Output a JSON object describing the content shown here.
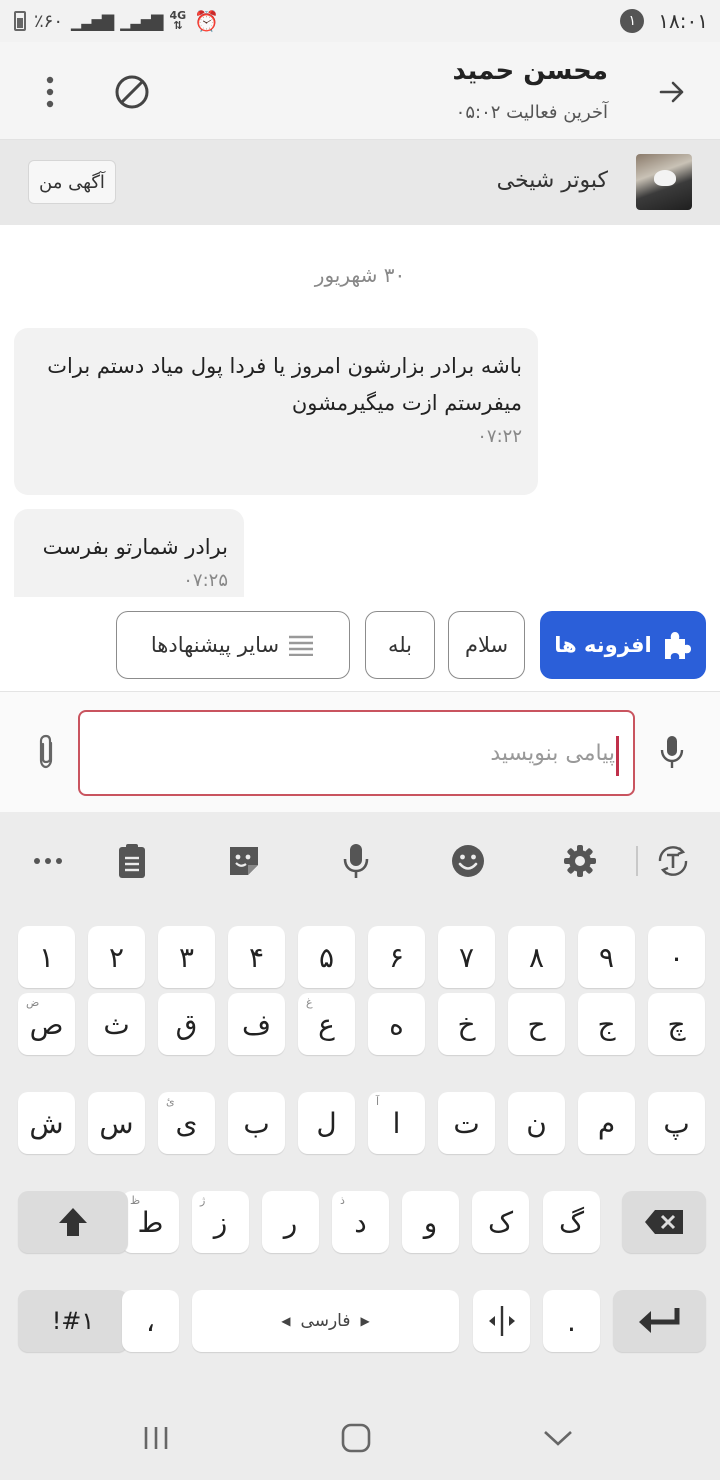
{
  "status_bar": {
    "battery_text": "٪۶۰",
    "network": "4G",
    "notification_count": "۱",
    "time": "۱۸:۰۱"
  },
  "header": {
    "contact_name": "محسن حمید",
    "last_seen": "آخرین فعالیت ۰۵:۰۲"
  },
  "ad": {
    "title": "کبوتر شیخی",
    "my_ad_label": "آگهی من"
  },
  "chat": {
    "date_separator": "۳۰ شهریور",
    "messages": [
      {
        "text": "باشه برادر بزارشون امروز یا فردا پول میاد دستم برات میفرستم ازت میگیرمشون",
        "time": "۰۷:۲۲"
      },
      {
        "text": "برادر شمارتو بفرست",
        "time": "۰۷:۲۵"
      }
    ]
  },
  "suggestions": {
    "addons": "افزونه ها",
    "salam": "سلام",
    "bale": "بله",
    "more": "سایر پیشنهادها"
  },
  "composer": {
    "placeholder": "پیامی بنویسید",
    "value": ""
  },
  "keyboard": {
    "number_row": [
      "۱",
      "۲",
      "۳",
      "۴",
      "۵",
      "۶",
      "۷",
      "۸",
      "۹",
      "۰"
    ],
    "row1": [
      "ص",
      "ث",
      "ق",
      "ف",
      "ع",
      "ه",
      "خ",
      "ح",
      "ج",
      "چ"
    ],
    "row1_hints": [
      "ض",
      "",
      "",
      "",
      "غ",
      "",
      "",
      "",
      "",
      ""
    ],
    "row2": [
      "ش",
      "س",
      "ی",
      "ب",
      "ل",
      "ا",
      "ت",
      "ن",
      "م",
      "پ"
    ],
    "row2_hints": [
      "",
      "",
      "ئ",
      "",
      "",
      "آ",
      "",
      "",
      "",
      ""
    ],
    "row3": [
      "ط",
      "ز",
      "ر",
      "د",
      "و",
      "ک",
      "گ"
    ],
    "row3_hints": [
      "ظ",
      "ژ",
      "",
      "ذ",
      "",
      "",
      ""
    ],
    "symbols_key": "!#۱",
    "comma_key": "،",
    "space_label": "فارسی",
    "period_key": "."
  },
  "colors": {
    "accent_blue": "#2b5fd9",
    "input_border": "#c9545f",
    "bubble_bg": "#f2f2f2",
    "keyboard_bg": "#ececec"
  }
}
